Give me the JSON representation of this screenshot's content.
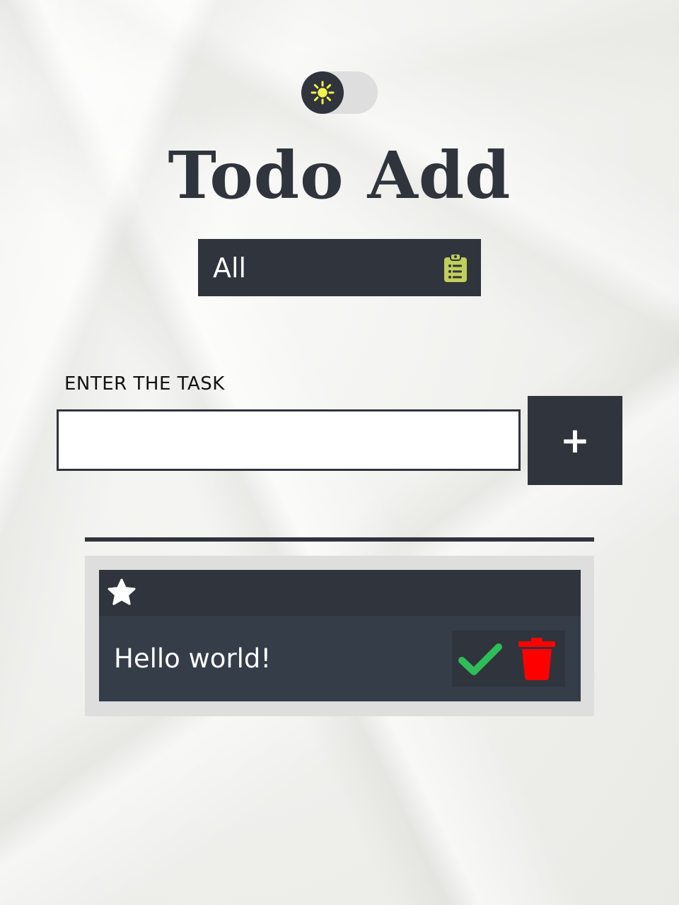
{
  "theme_toggle": {
    "icon": "sun-icon",
    "knob_color": "#2f343d",
    "sun_color": "#f5f24a"
  },
  "header": {
    "title": "Todo Add"
  },
  "filter": {
    "selected": "All",
    "icon": "clipboard-list-icon",
    "icon_color": "#bfcf5a"
  },
  "task_form": {
    "label": "ENTER THE TASK",
    "input_value": "",
    "add_label": "+"
  },
  "todos": [
    {
      "text": "Hello world!",
      "star_icon": "star-icon",
      "complete_icon": "check-icon",
      "delete_icon": "trash-icon",
      "complete_color": "#2ebd59",
      "delete_color": "#ff0000"
    }
  ],
  "colors": {
    "dark": "#2f343d",
    "item_body": "#353d49",
    "list_background": "#dedede"
  }
}
